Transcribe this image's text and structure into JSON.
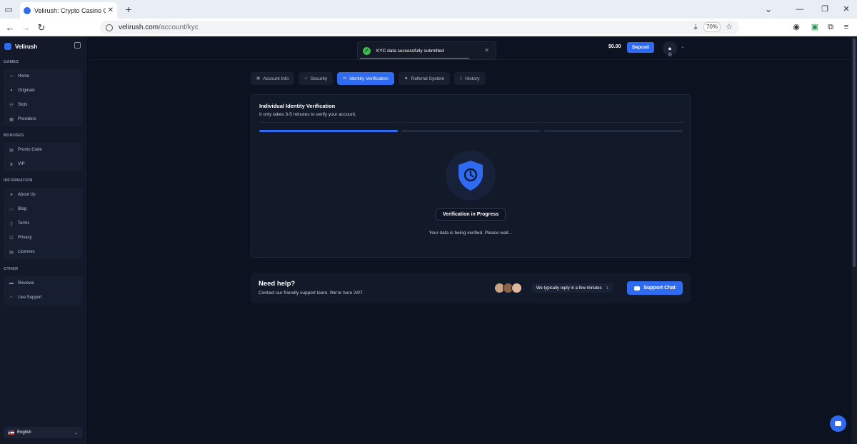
{
  "browser": {
    "tab_title": "Velirush: Crypto Casino Games & Slots",
    "url_domain": "velirush.com",
    "url_path": "/account/kyc",
    "zoom": "70%",
    "close_glyph": "✕",
    "new_tab_glyph": "+",
    "back_glyph": "←",
    "forward_glyph": "→",
    "reload_glyph": "↻",
    "minimize_glyph": "—",
    "restore_glyph": "❐",
    "close_window_glyph": "✕",
    "dropdown_glyph": "⌄"
  },
  "sidebar": {
    "brand": "Velirush",
    "sections": [
      {
        "title": "GAMES",
        "items": [
          {
            "label": "Home",
            "icon": "home-icon",
            "glyph": "⌂"
          },
          {
            "label": "Originals",
            "icon": "flame-icon",
            "glyph": "♦"
          },
          {
            "label": "Slots",
            "icon": "slots-icon",
            "glyph": "☷"
          },
          {
            "label": "Providers",
            "icon": "grid-icon",
            "glyph": "▦"
          }
        ]
      },
      {
        "title": "BONUSES",
        "items": [
          {
            "label": "Promo Code",
            "icon": "ticket-icon",
            "glyph": "▤"
          },
          {
            "label": "VIP",
            "icon": "crown-icon",
            "glyph": "♛"
          }
        ]
      },
      {
        "title": "INFORMATION",
        "items": [
          {
            "label": "About Us",
            "icon": "info-icon",
            "glyph": "●"
          },
          {
            "label": "Blog",
            "icon": "newspaper-icon",
            "glyph": "▭"
          },
          {
            "label": "Terms",
            "icon": "document-icon",
            "glyph": "▯"
          },
          {
            "label": "Privacy",
            "icon": "privacy-icon",
            "glyph": "☑"
          },
          {
            "label": "Licenses",
            "icon": "license-icon",
            "glyph": "▤"
          }
        ]
      },
      {
        "title": "OTHER",
        "items": [
          {
            "label": "Reviews",
            "icon": "reviews-icon",
            "glyph": "▬"
          },
          {
            "label": "Live Support",
            "icon": "headset-icon",
            "glyph": "◠"
          }
        ]
      }
    ],
    "language": "English"
  },
  "header": {
    "balance": "$0.00",
    "deposit": "Deposit"
  },
  "toast": {
    "message": "KYC data successfully submitted",
    "check_glyph": "✓",
    "close_glyph": "✕"
  },
  "tabs": [
    {
      "label": "Account Info",
      "icon": "account-icon",
      "glyph": "▣",
      "active": false
    },
    {
      "label": "Security",
      "icon": "shield-icon",
      "glyph": "◇",
      "active": false
    },
    {
      "label": "Identity Verification",
      "icon": "id-card-icon",
      "glyph": "▭",
      "active": true
    },
    {
      "label": "Referral System",
      "icon": "users-icon",
      "glyph": "☻",
      "active": false
    },
    {
      "label": "History",
      "icon": "history-icon",
      "glyph": "▯",
      "active": false
    }
  ],
  "kyc": {
    "title": "Individual Identity Verification",
    "subtitle": "It only takes 3-5 minutes to verify your account.",
    "steps_completed": 1,
    "steps_total": 3,
    "status": "Verification in Progress",
    "message": "Your data is being verified. Please wait..."
  },
  "help": {
    "title": "Need help?",
    "subtitle": "Contact our friendly support team. We're here 24/7.",
    "reply_text": "We typically reply in a few minutes",
    "reply_count": "1",
    "button": "Support Chat"
  },
  "colors": {
    "accent": "#2f6bf0",
    "success": "#3fb950",
    "background": "#0d1220",
    "panel": "#121a2a"
  }
}
